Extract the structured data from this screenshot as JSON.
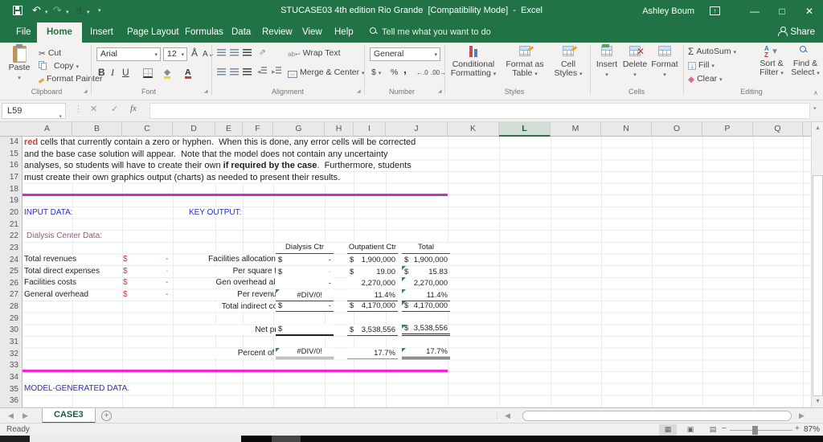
{
  "colors": {
    "excel_green": "#217346",
    "magenta_rule_top": "#c832be",
    "magenta_rule_bottom": "#ff1ed8",
    "blue_label": "#2b2bc8",
    "plum_label": "#a0527f",
    "red_text": "#e03232",
    "error_indicator_green": "#2f8a57"
  },
  "title_bar": {
    "title": "STUCASE03 4th edition Rio Grande  [Compatibility Mode]  -  Excel",
    "user": "Ashley Boum"
  },
  "ribbon_tabs": {
    "file": "File",
    "tabs": [
      "Home",
      "Insert",
      "Page Layout",
      "Formulas",
      "Data",
      "Review",
      "View",
      "Help"
    ],
    "active": "Home",
    "tell_me": "Tell me what you want to do",
    "share": "Share"
  },
  "ribbon": {
    "clipboard": {
      "label": "Clipboard",
      "paste": "Paste",
      "cut": "Cut",
      "copy": "Copy",
      "format_painter": "Format Painter"
    },
    "font": {
      "label": "Font",
      "name": "Arial",
      "size": "12",
      "bold": "B",
      "italic": "I",
      "underline": "U"
    },
    "alignment": {
      "label": "Alignment",
      "wrap": "Wrap Text",
      "merge": "Merge & Center"
    },
    "number": {
      "label": "Number",
      "format": "General",
      "dollar": "$",
      "percent": "%",
      "comma": ",",
      "inc_decimal": ".0",
      "dec_decimal": ".00"
    },
    "styles": {
      "label": "Styles",
      "conditional_1": "Conditional",
      "conditional_2": "Formatting",
      "format_table_1": "Format as",
      "format_table_2": "Table",
      "cell_styles_1": "Cell",
      "cell_styles_2": "Styles"
    },
    "cells": {
      "label": "Cells",
      "insert": "Insert",
      "delete": "Delete",
      "format": "Format"
    },
    "editing": {
      "label": "Editing",
      "autosum": "AutoSum",
      "fill": "Fill",
      "clear": "Clear",
      "sort_1": "Sort &",
      "sort_2": "Filter",
      "find_1": "Find &",
      "find_2": "Select"
    }
  },
  "formula_bar": {
    "name_box": "L59",
    "fx": "fx"
  },
  "grid": {
    "columns": [
      "A",
      "B",
      "C",
      "D",
      "E",
      "F",
      "G",
      "H",
      "I",
      "J",
      "K",
      "L",
      "M",
      "N",
      "O",
      "P",
      "Q"
    ],
    "selected_column": "L",
    "rows": [
      "14",
      "15",
      "16",
      "17",
      "18",
      "19",
      "20",
      "21",
      "22",
      "23",
      "24",
      "25",
      "26",
      "27",
      "28",
      "29",
      "30",
      "31",
      "32",
      "33",
      "34",
      "35",
      "36"
    ]
  },
  "sheet": {
    "notes": {
      "l1_red": "red",
      "l1_rest": " cells that currently contain a zero or hyphen.  When this is done, any error cells will be corrected",
      "l2": "and the base case solution will appear.  Note that the model does not contain any uncertainty",
      "l3_pre": "analyses, so students will have to create their own ",
      "l3_bold": "if required by the case",
      "l3_post": ".  Furthermore, students",
      "l4": "must create their own graphics output (charts) as needed to present their results."
    },
    "input_data_label": "INPUT DATA:",
    "key_output_label": "KEY OUTPUT:",
    "section_label": "Dialysis Center Data:",
    "model_label": "MODEL-GENERATED DATA.",
    "table": {
      "headers": [
        "Dialysis Ctr",
        "Outpatient Ctr",
        "Total"
      ],
      "input_rows": [
        {
          "label": "Total revenues",
          "cur": "$",
          "val": "-"
        },
        {
          "label": "Total direct expenses",
          "cur": "$",
          "val": "-"
        },
        {
          "label": "Facilities costs",
          "cur": "$",
          "val": "-"
        },
        {
          "label": "General overhead",
          "cur": "$",
          "val": "-"
        }
      ],
      "output_rows": [
        {
          "label": "Facilities allocation ($)",
          "c1_cur": "$",
          "c1_val": "-",
          "c2_cur": "$",
          "c2_val": "1,900,000",
          "c3_cur": "$",
          "c3_val": "1,900,000"
        },
        {
          "label": "Per square foot",
          "c1_cur": "$",
          "c1_val": "-",
          "c2_cur": "$",
          "c2_val": "19.00",
          "c3_cur": "$",
          "c3_val": "15.83"
        },
        {
          "label": "Gen overhead alloc.",
          "c1_cur": "",
          "c1_val": "-",
          "c2_cur": "",
          "c2_val": "2,270,000",
          "c3_cur": "",
          "c3_val": "2,270,000"
        },
        {
          "label": "Per revenue $",
          "c1_cur": "",
          "c1_val": "#DIV/0!",
          "c2_cur": "",
          "c2_val": "11.4%",
          "c3_cur": "",
          "c3_val": "11.4%"
        },
        {
          "label": "Total indirect costs",
          "c1_cur": "$",
          "c1_val": "-",
          "c2_cur": "$",
          "c2_val": "4,170,000",
          "c3_cur": "$",
          "c3_val": "4,170,000"
        },
        {
          "label": "Net profit",
          "c1_cur": "$",
          "c1_val": "",
          "c2_cur": "$",
          "c2_val": "3,538,556",
          "c3_cur": "$",
          "c3_val": "3,538,556"
        },
        {
          "label": "Percent of rev",
          "c1_cur": "",
          "c1_val": "#DIV/0!",
          "c2_cur": "",
          "c2_val": "17.7%",
          "c3_cur": "",
          "c3_val": "17.7%"
        }
      ]
    }
  },
  "sheet_tabs": {
    "active": "CASE3"
  },
  "status_bar": {
    "mode": "Ready",
    "zoom": "87%"
  }
}
